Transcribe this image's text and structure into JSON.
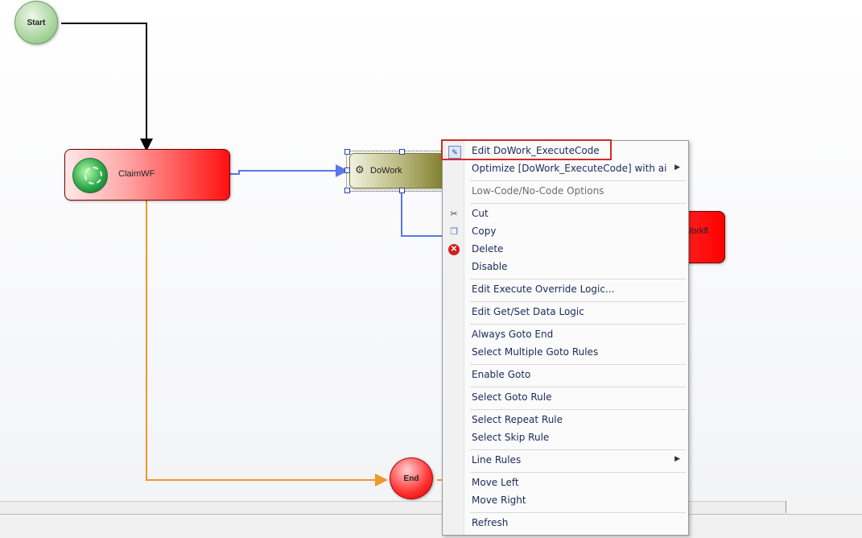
{
  "canvas": {
    "nodes": {
      "start": "Start",
      "end": "End",
      "claim": "ClaimWF",
      "dowork": "DoWork",
      "workfl": "Workfl"
    },
    "connector_colors": {
      "start_to_claim": "#000000",
      "claim_to_dowork": "#5a78e6",
      "claim_to_end": "#f0962a"
    }
  },
  "context_menu": {
    "items": [
      {
        "label": "Edit DoWork_ExecuteCode",
        "icon": "edit-icon",
        "highlighted": true
      },
      {
        "label": "Optimize [DoWork_ExecuteCode] with ai",
        "submenu": true
      },
      {
        "label": "Low-Code/No-Code Options",
        "disabled": true
      },
      {
        "label": "Cut",
        "icon": "cut-icon"
      },
      {
        "label": "Copy",
        "icon": "copy-icon"
      },
      {
        "label": "Delete",
        "icon": "delete-icon"
      },
      {
        "label": "Disable"
      },
      {
        "label": "Edit Execute Override Logic..."
      },
      {
        "label": "Edit Get/Set Data Logic"
      },
      {
        "label": "Always Goto End"
      },
      {
        "label": "Select Multiple Goto Rules"
      },
      {
        "label": "Enable Goto"
      },
      {
        "label": "Select Goto Rule"
      },
      {
        "label": "Select Repeat Rule"
      },
      {
        "label": "Select Skip Rule"
      },
      {
        "label": "Line Rules",
        "submenu": true
      },
      {
        "label": "Move Left"
      },
      {
        "label": "Move Right"
      },
      {
        "label": "Refresh"
      }
    ]
  }
}
